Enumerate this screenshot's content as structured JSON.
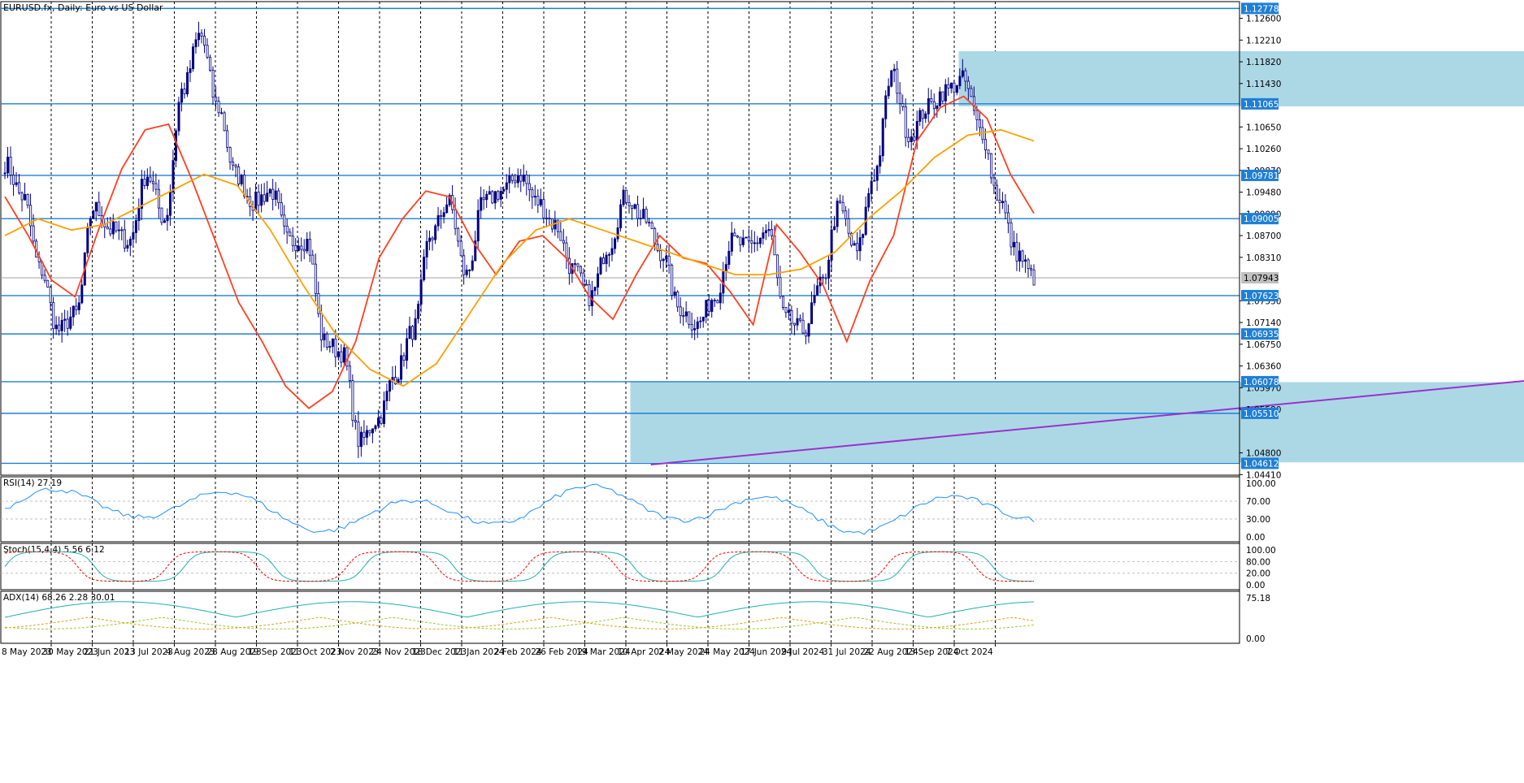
{
  "window": {
    "title": "EURUSD.fx, Daily:  Euro vs US Dollar"
  },
  "chart_data": {
    "type": "candlestick",
    "title": "EURUSD.fx, Daily:  Euro vs US Dollar",
    "symbol": "EURUSD.fx",
    "timeframe": "Daily",
    "ylim": [
      1.044,
      1.129
    ],
    "grid": true,
    "x_labels": [
      "8 May 2023",
      "30 May 2023",
      "21 Jun 2023",
      "13 Jul 2023",
      "4 Aug 2023",
      "28 Aug 2023",
      "19 Sep 2023",
      "11 Oct 2023",
      "2 Nov 2023",
      "24 Nov 2023",
      "18 Dec 2023",
      "11 Jan 2024",
      "2 Feb 2024",
      "26 Feb 2024",
      "19 Mar 2024",
      "10 Apr 2024",
      "2 May 2024",
      "24 May 2024",
      "17 Jun 2024",
      "9 Jul 2024",
      "31 Jul 2024",
      "22 Aug 2024",
      "13 Sep 2024",
      "7 Oct 2024"
    ],
    "y_ticks": [
      "1.12600",
      "1.12210",
      "1.11820",
      "1.11430",
      "1.10650",
      "1.10260",
      "1.09870",
      "1.09480",
      "1.09090",
      "1.08700",
      "1.08310",
      "1.07530",
      "1.07140",
      "1.06750",
      "1.06360",
      "1.05970",
      "1.05580",
      "1.04800",
      "1.04410"
    ],
    "current_price": "1.07943",
    "levels": [
      "1.12778",
      "1.11065",
      "1.09781",
      "1.09005",
      "1.07623",
      "1.06935",
      "1.06078",
      "1.05510",
      "1.04612"
    ],
    "zones": [
      {
        "name": "resistance-zone",
        "from": 1.1102,
        "to": 1.1201,
        "start_index": 23,
        "end_index": 50
      },
      {
        "name": "support-zone",
        "from": 1.0463,
        "to": 1.0607,
        "start_index": 15,
        "end_index": 47
      }
    ],
    "trendline": {
      "from_price": 1.0459,
      "to_price": 1.0801,
      "start_index": 15.5,
      "end_index": 60.5
    },
    "close_anchors": [
      1.1,
      1.094,
      1.081,
      1.07,
      1.073,
      1.092,
      1.088,
      1.086,
      1.098,
      1.09,
      1.113,
      1.123,
      1.11,
      1.098,
      1.093,
      1.095,
      1.086,
      1.086,
      1.068,
      1.066,
      1.05,
      1.054,
      1.062,
      1.07,
      1.087,
      1.093,
      1.08,
      1.093,
      1.095,
      1.098,
      1.093,
      1.089,
      1.081,
      1.076,
      1.085,
      1.094,
      1.09,
      1.084,
      1.074,
      1.071,
      1.076,
      1.086,
      1.085,
      1.088,
      1.072,
      1.07,
      1.078,
      1.092,
      1.084,
      1.098,
      1.116,
      1.105,
      1.11,
      1.113,
      1.115,
      1.106,
      1.094,
      1.084,
      1.0795
    ],
    "ma_fast": [
      1.094,
      1.087,
      1.079,
      1.076,
      1.088,
      1.099,
      1.106,
      1.107,
      1.097,
      1.086,
      1.075,
      1.068,
      1.06,
      1.056,
      1.059,
      1.068,
      1.083,
      1.09,
      1.095,
      1.094,
      1.086,
      1.08,
      1.086,
      1.087,
      1.083,
      1.076,
      1.072,
      1.08,
      1.087,
      1.083,
      1.082,
      1.077,
      1.071,
      1.089,
      1.084,
      1.078,
      1.068,
      1.079,
      1.087,
      1.104,
      1.11,
      1.112,
      1.108,
      1.098,
      1.091
    ],
    "ma_slow": [
      1.087,
      1.09,
      1.088,
      1.089,
      1.092,
      1.095,
      1.098,
      1.096,
      1.088,
      1.078,
      1.069,
      1.063,
      1.06,
      1.064,
      1.073,
      1.082,
      1.088,
      1.09,
      1.088,
      1.086,
      1.084,
      1.082,
      1.08,
      1.08,
      1.081,
      1.084,
      1.09,
      1.095,
      1.101,
      1.105,
      1.106,
      1.104
    ],
    "indicators": [
      {
        "name": "RSI(14) 27.19",
        "levels": [
          "100.00",
          "70.00",
          "30.00",
          "0.00"
        ]
      },
      {
        "name": "Stoch(15,4,4) 5.56 6.12",
        "levels": [
          "100.00",
          "80.00",
          "20.00",
          "0.00"
        ]
      },
      {
        "name": "ADX(14) 68.26 2.28 30.01",
        "levels": [
          "75.18",
          "0.00"
        ]
      }
    ]
  },
  "colors": {
    "bull": "#000080",
    "bear": "#000080",
    "level_line": "#1e7fd6",
    "level_box": "#1e7fd6",
    "zone": "#acd8e6",
    "ma_fast": "#ff4020",
    "ma_slow": "#ffa000",
    "trendline": "#9a32cd",
    "rsi": "#1e90ff",
    "stoch_main": "#20b2aa",
    "stoch_signal": "#ff0000",
    "adx_main": "#20b2aa",
    "adx_plus": "#9acd32",
    "adx_minus": "#daa520",
    "price_box": "#c0c0c0"
  }
}
